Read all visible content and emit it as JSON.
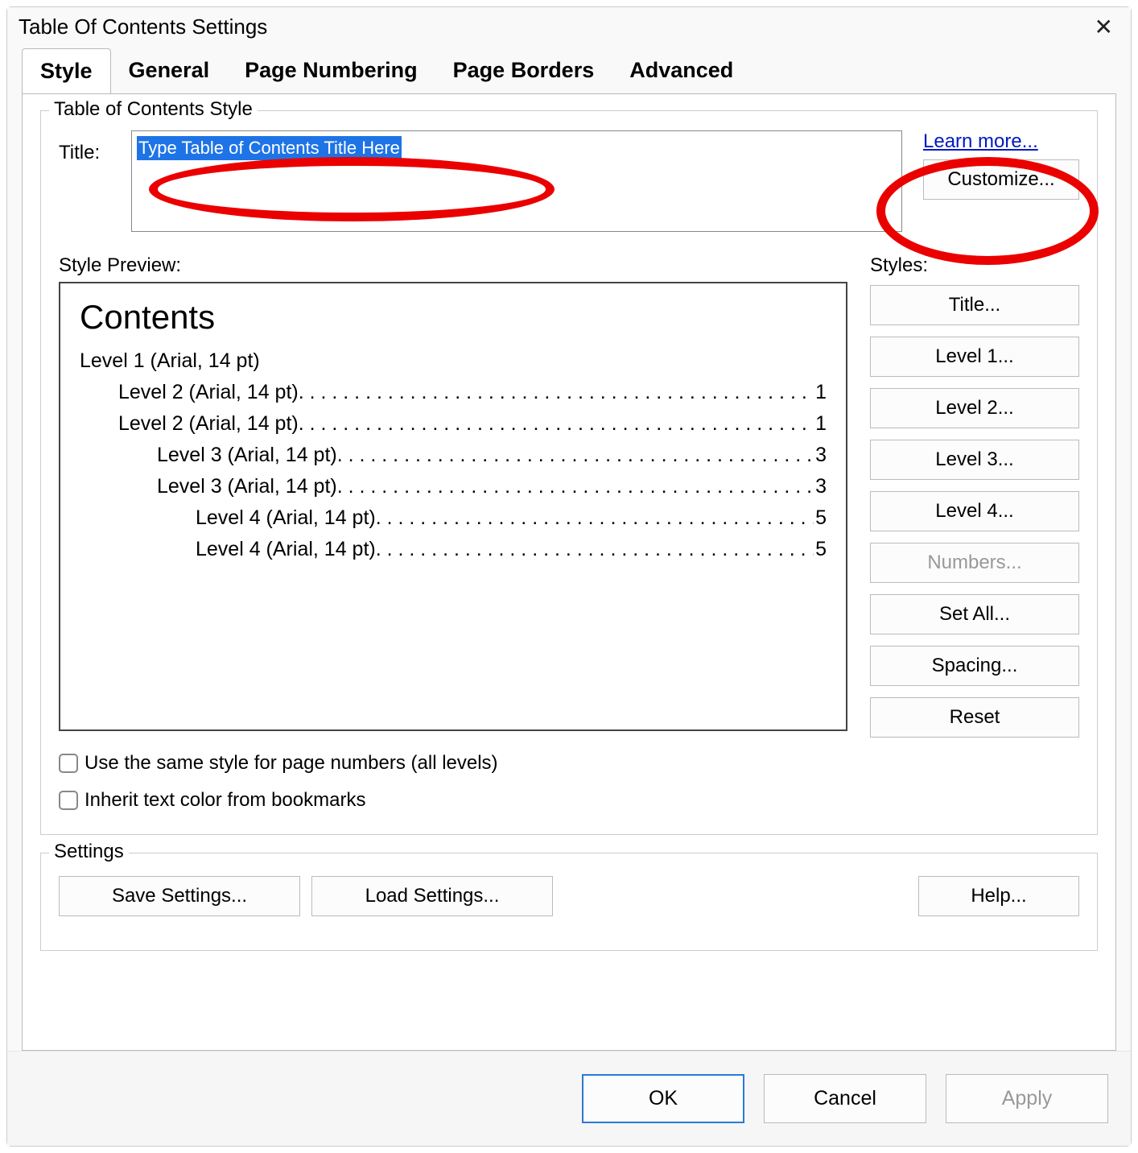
{
  "dialog": {
    "title": "Table Of Contents Settings"
  },
  "tabs": {
    "style": "Style",
    "general": "General",
    "page_numbering": "Page Numbering",
    "page_borders": "Page Borders",
    "advanced": "Advanced"
  },
  "group_style_title": "Table of Contents Style",
  "title_label": "Title:",
  "title_value": "Type Table of Contents Title Here",
  "learn_more": "Learn more...",
  "customize": "Customize...",
  "preview_label": "Style Preview:",
  "preview": {
    "heading": "Contents",
    "lines": [
      {
        "indent": 1,
        "text": "Level 1 (Arial, 14 pt)",
        "page": ""
      },
      {
        "indent": 2,
        "text": "Level 2 (Arial, 14 pt)",
        "page": "1"
      },
      {
        "indent": 2,
        "text": "Level 2 (Arial, 14 pt)",
        "page": "1"
      },
      {
        "indent": 3,
        "text": "Level 3 (Arial, 14 pt)",
        "page": "3"
      },
      {
        "indent": 3,
        "text": "Level 3 (Arial, 14 pt)",
        "page": "3"
      },
      {
        "indent": 4,
        "text": "Level 4 (Arial, 14 pt)",
        "page": "5"
      },
      {
        "indent": 4,
        "text": "Level 4 (Arial, 14 pt)",
        "page": "5"
      }
    ]
  },
  "styles_label": "Styles:",
  "style_buttons": {
    "title": "Title...",
    "level1": "Level 1...",
    "level2": "Level 2...",
    "level3": "Level 3...",
    "level4": "Level 4...",
    "numbers": "Numbers...",
    "set_all": "Set All...",
    "spacing": "Spacing...",
    "reset": "Reset"
  },
  "chk_same_style": "Use the same style for page numbers (all levels)",
  "chk_inherit": "Inherit text color from bookmarks",
  "settings_label": "Settings",
  "save_settings": "Save Settings...",
  "load_settings": "Load Settings...",
  "help": "Help...",
  "ok": "OK",
  "cancel": "Cancel",
  "apply": "Apply"
}
